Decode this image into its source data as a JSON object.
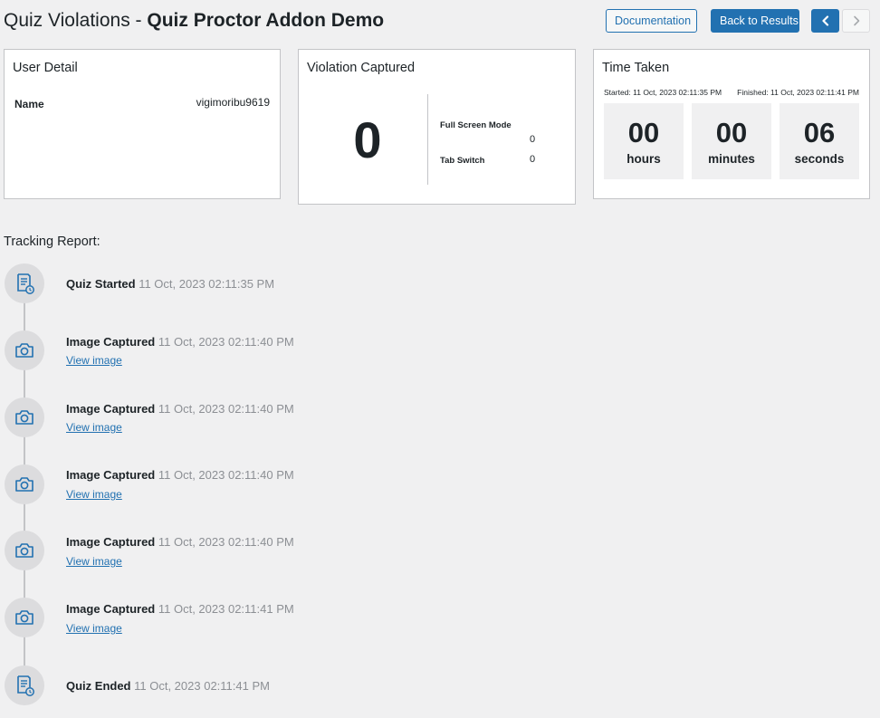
{
  "header": {
    "title_prefix": "Quiz Violations - ",
    "title_strong": "Quiz Proctor Addon Demo",
    "documentation_label": "Documentation",
    "back_label": "Back to Results"
  },
  "user_detail": {
    "title": "User Detail",
    "name_label": "Name",
    "name_value": "vigimoribu9619"
  },
  "violation": {
    "title": "Violation Captured",
    "total": "0",
    "items": [
      {
        "label": "Full Screen Mode",
        "value": "0"
      },
      {
        "label": "Tab Switch",
        "value": "0"
      }
    ]
  },
  "time_taken": {
    "title": "Time Taken",
    "started": "Started: 11 Oct, 2023 02:11:35 PM",
    "finished": "Finished: 11 Oct, 2023 02:11:41 PM",
    "units": [
      {
        "value": "00",
        "label": "hours"
      },
      {
        "value": "00",
        "label": "minutes"
      },
      {
        "value": "06",
        "label": "seconds"
      }
    ]
  },
  "tracking": {
    "title": "Tracking Report:",
    "events": [
      {
        "icon": "document-clock-icon",
        "title": "Quiz Started",
        "time": "11 Oct, 2023 02:11:35 PM"
      },
      {
        "icon": "camera-icon",
        "title": "Image Captured",
        "time": "11 Oct, 2023 02:11:40 PM",
        "link": "View image"
      },
      {
        "icon": "camera-icon",
        "title": "Image Captured",
        "time": "11 Oct, 2023 02:11:40 PM",
        "link": "View image"
      },
      {
        "icon": "camera-icon",
        "title": "Image Captured",
        "time": "11 Oct, 2023 02:11:40 PM",
        "link": "View image"
      },
      {
        "icon": "camera-icon",
        "title": "Image Captured",
        "time": "11 Oct, 2023 02:11:40 PM",
        "link": "View image"
      },
      {
        "icon": "camera-icon",
        "title": "Image Captured",
        "time": "11 Oct, 2023 02:11:41 PM",
        "link": "View image"
      },
      {
        "icon": "document-clock-icon",
        "title": "Quiz Ended",
        "time": "11 Oct, 2023 02:11:41 PM"
      }
    ]
  },
  "colors": {
    "accent": "#2271b1",
    "background": "#f0f0f1",
    "icon_circle": "#dcdcde"
  }
}
